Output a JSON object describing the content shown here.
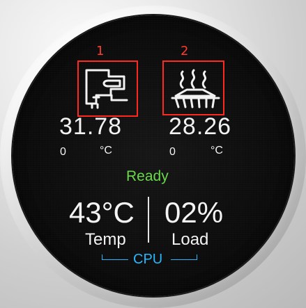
{
  "markers": {
    "sensor_1_number": "1",
    "sensor_2_number": "2"
  },
  "sensors": [
    {
      "icon": "cpu-board-icon",
      "value": "31.78",
      "left_small": "0",
      "unit": "°C"
    },
    {
      "icon": "heatsink-heat-icon",
      "value": "28.26",
      "left_small": "0",
      "unit": "°C"
    }
  ],
  "status": {
    "text": "Ready",
    "color": "#69d94a"
  },
  "cpu": {
    "temp_value": "43°C",
    "temp_label": "Temp",
    "load_value": "02%",
    "load_label": "Load",
    "section_label": "CPU",
    "accent_color": "#27b7ff"
  },
  "colors": {
    "highlight": "#ff2a1f",
    "text": "#f2f2f2",
    "screen": "#0d0d0d"
  }
}
